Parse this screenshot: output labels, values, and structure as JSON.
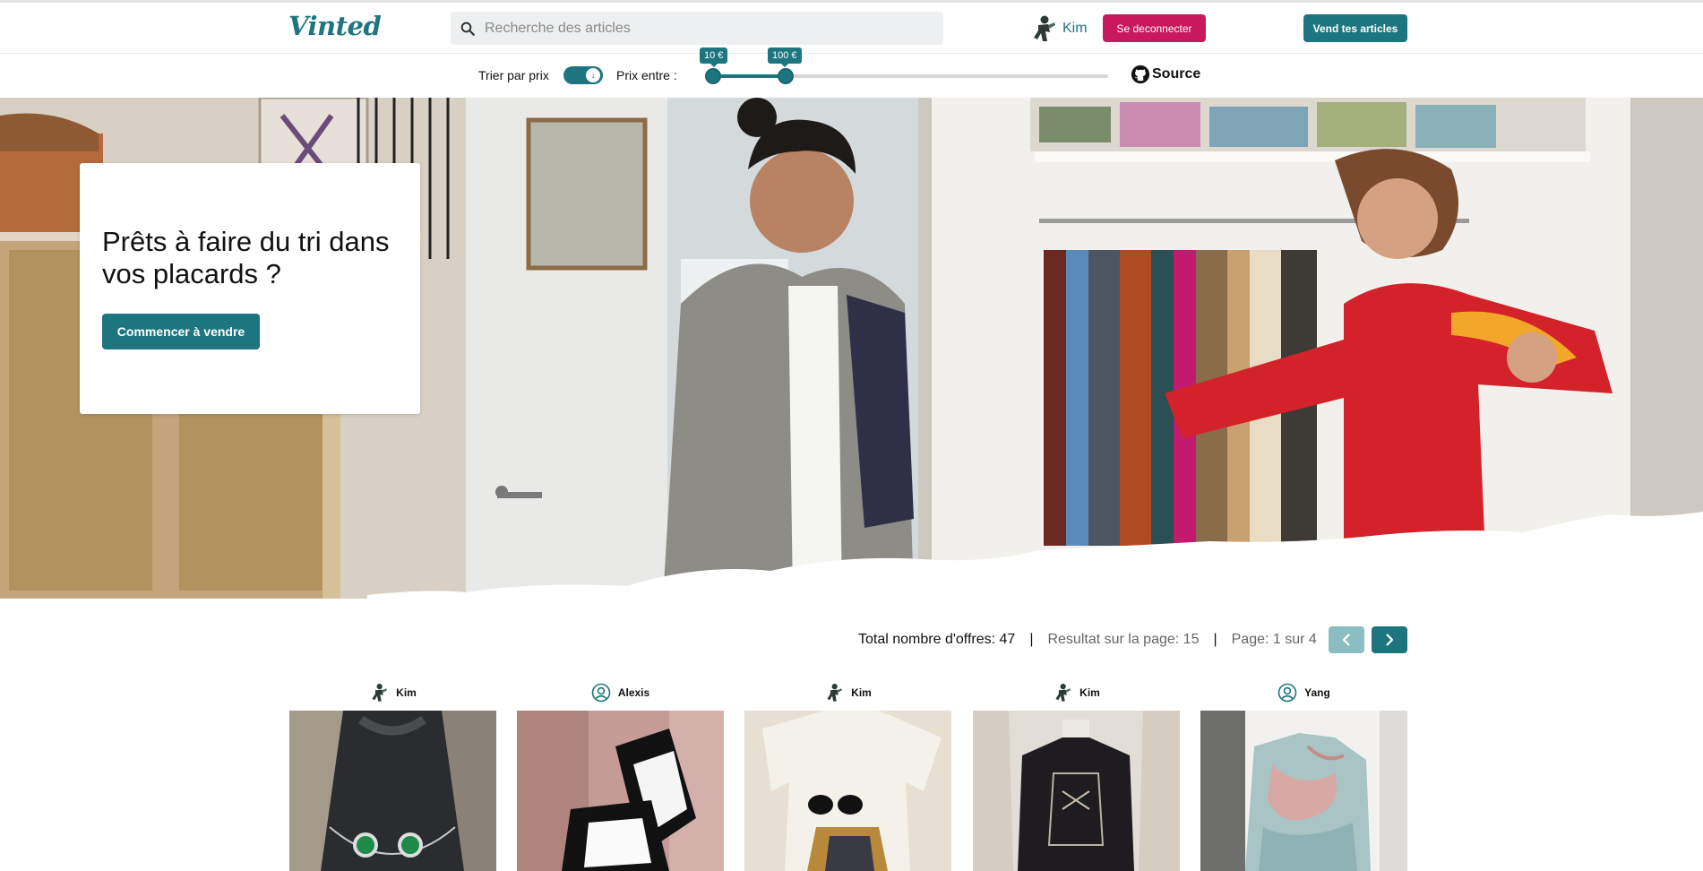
{
  "header": {
    "logo_text": "Vinted",
    "search_placeholder": "Recherche des articles",
    "user_name": "Kim",
    "logout_label": "Se deconnecter",
    "sell_label": "Vend tes articles"
  },
  "filters": {
    "sort_label": "Trier par prix",
    "sort_enabled": true,
    "price_label": "Prix entre :",
    "price_min_label": "10 €",
    "price_max_label": "100 €",
    "price_min": 10,
    "price_max": 100,
    "source_label": "Source"
  },
  "hero": {
    "title": "Prêts à faire du tri dans vos placards ?",
    "cta_label": "Commencer à vendre"
  },
  "results": {
    "total_label": "Total nombre d'offres: 47",
    "per_page_label": "Resultat sur la page: 15",
    "page_label": "Page: 1 sur 4",
    "separator": "|"
  },
  "products": [
    {
      "owner": "Kim",
      "avatar": "user-photo-avatar"
    },
    {
      "owner": "Alexis",
      "avatar": "user-outline-icon"
    },
    {
      "owner": "Kim",
      "avatar": "user-photo-avatar"
    },
    {
      "owner": "Kim",
      "avatar": "user-photo-avatar"
    },
    {
      "owner": "Yang",
      "avatar": "user-outline-icon"
    }
  ],
  "colors": {
    "brand": "#1d7580",
    "logout": "#c8195e",
    "prev_disabled": "#8bbec2"
  }
}
